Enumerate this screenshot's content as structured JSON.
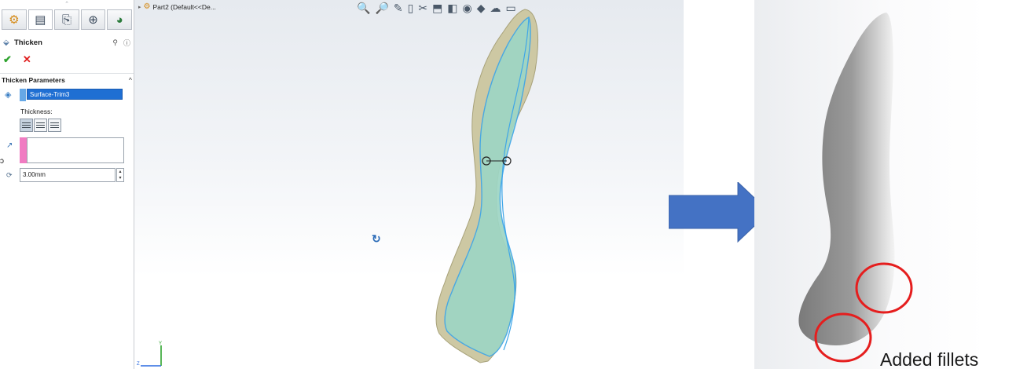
{
  "pm": {
    "grip": "⌃",
    "tabs": [
      {
        "icon": "feature-manager-icon",
        "glyph": "⚙"
      },
      {
        "icon": "property-manager-icon",
        "glyph": "▤"
      },
      {
        "icon": "configuration-manager-icon",
        "glyph": "⎘"
      },
      {
        "icon": "dimxpert-icon",
        "glyph": "⊕"
      },
      {
        "icon": "display-manager-icon",
        "glyph": "◕"
      }
    ],
    "title": "Thicken",
    "ok_glyph": "✔",
    "cancel_glyph": "✕",
    "group_title": "Thicken Parameters",
    "group_collapse": "^",
    "face_value": "Surface-Trim3",
    "thickness_label": "Thickness:",
    "thickness_options": [
      "side-1",
      "both-sides",
      "side-2"
    ],
    "side_mark": "ↄ",
    "depth_value": "3.00mm",
    "edge_tab": "‹"
  },
  "viewport": {
    "tree_label": "Part2  (Default<<De...",
    "tree_arrow": "▸",
    "toolbar_icons": [
      "zoom-to-fit-icon",
      "zoom-to-area-icon",
      "previous-view-icon",
      "section-view-icon",
      "dynamic-annotation-icon",
      "view-orientation-icon",
      "display-style-icon",
      "hide-show-items-icon",
      "edit-appearance-icon",
      "apply-scene-icon",
      "view-settings-icon"
    ],
    "toolbar_glyphs": [
      "🔍",
      "🔎",
      "✎",
      "▯",
      "✂",
      "⬒",
      "▾",
      "◧",
      "▾",
      "◉",
      "▾",
      "◆",
      "▾",
      "☁",
      "▾",
      "▭",
      "▾"
    ],
    "rotate_glyph": "↻",
    "triad_y": "Y",
    "triad_z": "Z"
  },
  "caption": "Added fillets",
  "colors": {
    "surface_fill": "#9ed6c4",
    "thick_edge": "#cdc8a3",
    "surface_edge": "#3fa6e8",
    "arrow": "#4472c4",
    "fillet_circle": "#e51e1e",
    "result_body": "#8c8c8c"
  }
}
